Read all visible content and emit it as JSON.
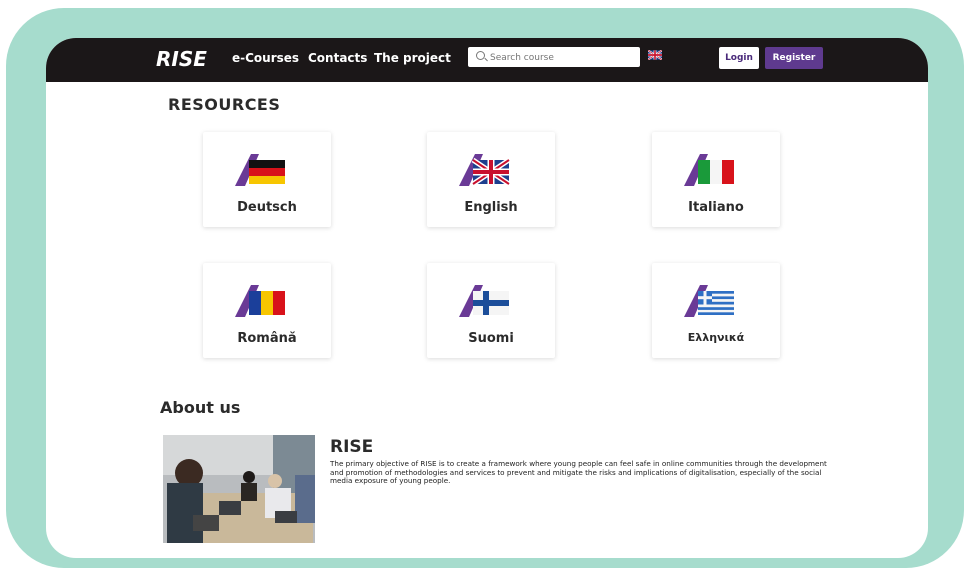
{
  "navbar": {
    "logo": "RISE",
    "links": [
      "e-Courses",
      "Contacts",
      "The project"
    ],
    "search_placeholder": "Search course",
    "login": "Login",
    "register": "Register"
  },
  "resources": {
    "title": "RESOURCES",
    "languages": [
      {
        "label": "Deutsch",
        "flag": "germany-flag-icon"
      },
      {
        "label": "English",
        "flag": "uk-flag-icon"
      },
      {
        "label": "Italiano",
        "flag": "italy-flag-icon"
      },
      {
        "label": "Română",
        "flag": "romania-flag-icon"
      },
      {
        "label": "Suomi",
        "flag": "finland-flag-icon"
      },
      {
        "label": "Ελληνικά",
        "flag": "greece-flag-icon"
      }
    ]
  },
  "about": {
    "title": "About us",
    "heading": "RISE",
    "text": "The primary objective of RISE is to create a framework where young people can feel safe in online communities through the development and promotion of methodologies and services to prevent and mitigate the risks and implications of digitalisation, especially of the social media exposure of young people."
  },
  "colors": {
    "frame": "#a6dccd",
    "navbar": "#1b1718",
    "accent": "#5f3a8f"
  }
}
